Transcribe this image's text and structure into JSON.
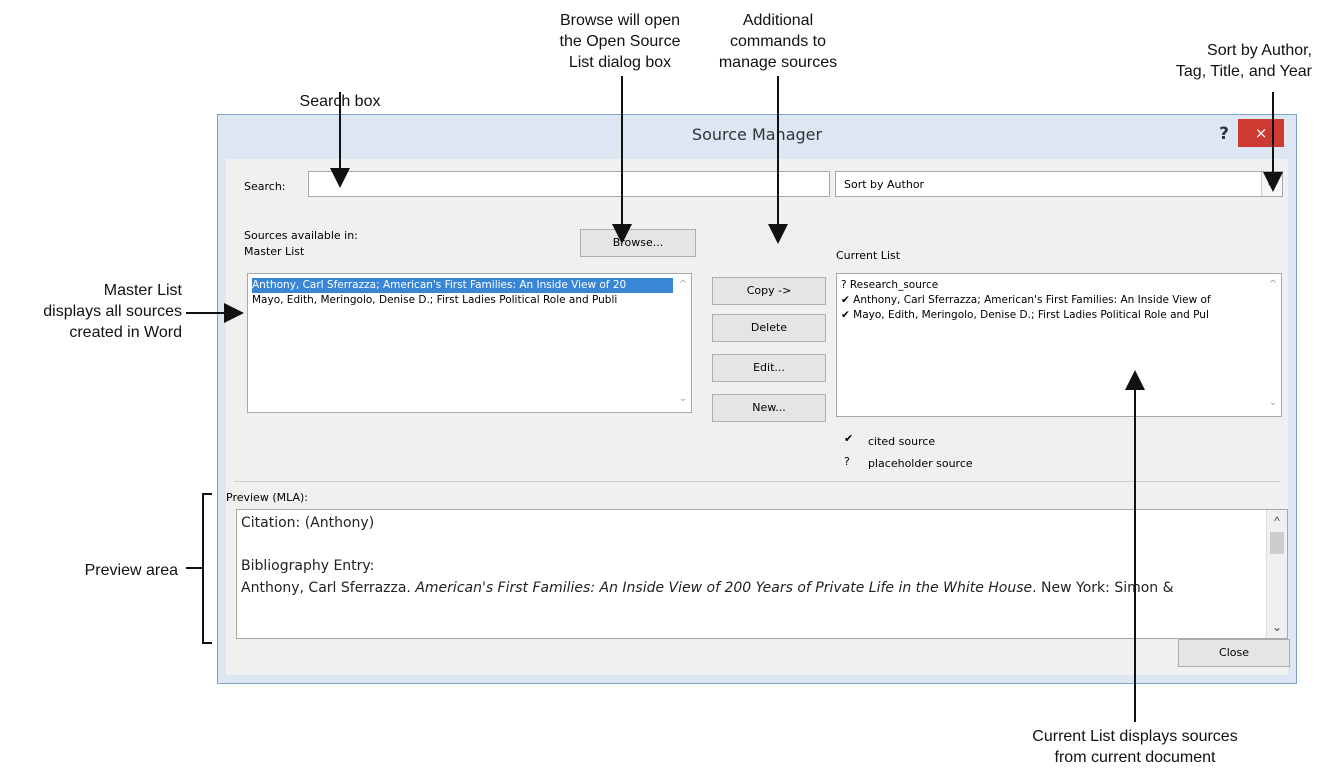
{
  "callouts": {
    "search_box": "Search box",
    "browse": "Browse will open\nthe Open Source\nList dialog box",
    "additional": "Additional\ncommands to\nmanage sources",
    "sort": "Sort by Author,\nTag, Title, and Year",
    "master_list": "Master List\ndisplays all sources\ncreated in Word",
    "preview_area": "Preview area",
    "current_list": "Current List displays sources\nfrom current document"
  },
  "dialog": {
    "title": "Source Manager",
    "help_label": "?",
    "close_glyph": "×"
  },
  "search": {
    "label": "Search:",
    "value": ""
  },
  "sort": {
    "selected": "Sort by Author",
    "arrow": "⌵"
  },
  "sources": {
    "label": "Sources available in:",
    "master_label": "Master List",
    "browse_label": "Browse...",
    "master_items": [
      "Anthony, Carl Sferrazza; American's First Families: An Inside View of 20",
      "Mayo, Edith, Meringolo, Denise D.; First Ladies Political Role and Publi"
    ]
  },
  "actions": {
    "copy": "Copy ->",
    "delete": "Delete",
    "edit": "Edit...",
    "new": "New..."
  },
  "current": {
    "label": "Current List",
    "items": [
      {
        "mark": "?",
        "text": "Research_source"
      },
      {
        "mark": "✔",
        "text": "Anthony, Carl Sferrazza; American's First Families: An Inside View of"
      },
      {
        "mark": "✔",
        "text": "Mayo, Edith, Meringolo, Denise D.; First Ladies Political Role and Pul"
      }
    ],
    "legend": [
      {
        "mark": "✔",
        "text": "cited source"
      },
      {
        "mark": "?",
        "text": "placeholder source"
      }
    ]
  },
  "preview": {
    "label": "Preview (MLA):",
    "citation": "Citation:  (Anthony)",
    "bib_heading": "Bibliography Entry:",
    "bib_author": "Anthony, Carl Sferrazza. ",
    "bib_title": "American's First Families: An Inside View of 200 Years of Private Life in the White House",
    "bib_rest": ". New York: Simon &"
  },
  "footer": {
    "close_label": "Close"
  },
  "scroll": {
    "up": "^",
    "down": "⌄"
  }
}
